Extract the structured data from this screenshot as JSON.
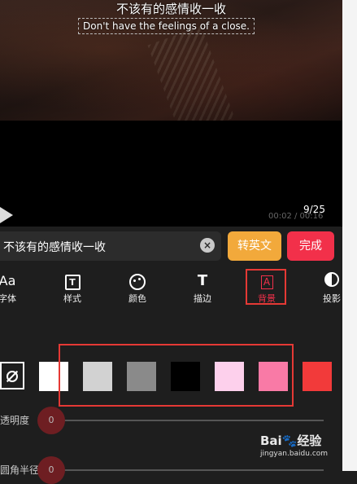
{
  "video": {
    "subtitle_cn": "不该有的感情收一收",
    "subtitle_en": "Don't have the feelings of a close.",
    "time_readout": "00:02 / 00:16",
    "counter": "9/25"
  },
  "input": {
    "value": "不该有的感情收一收",
    "clear_glyph": "×"
  },
  "buttons": {
    "translate_label": "转英文",
    "done_label": "完成",
    "translate_color": "#f2a93b",
    "done_color": "#f2304a"
  },
  "tabs": [
    {
      "label": "字体",
      "icon_text": "Aa",
      "icon": "font-icon"
    },
    {
      "label": "样式",
      "icon_text": "T",
      "icon": "style-icon"
    },
    {
      "label": "颜色",
      "icon": "palette-icon"
    },
    {
      "label": "描边",
      "icon_text": "T",
      "icon": "stroke-icon"
    },
    {
      "label": "背景",
      "icon_text": "A",
      "icon": "background-icon",
      "active": true
    },
    {
      "label": "投影",
      "icon": "shadow-icon"
    }
  ],
  "swatches": [
    {
      "name": "white",
      "color": "#ffffff"
    },
    {
      "name": "light-gray",
      "color": "#d2d2d2"
    },
    {
      "name": "gray",
      "color": "#8a8a8a"
    },
    {
      "name": "black",
      "color": "#000000"
    },
    {
      "name": "light-pink",
      "color": "#fdd0ec"
    },
    {
      "name": "pink",
      "color": "#f97aa6"
    },
    {
      "name": "red",
      "color": "#f23a3a"
    }
  ],
  "sliders": [
    {
      "label": "透明度",
      "value": "0"
    },
    {
      "label": "圆角半径",
      "value": "0"
    }
  ],
  "watermark": {
    "logo_pre": "Bai",
    "logo_paw": "🐾",
    "logo_post": "经验",
    "url": "jingyan.baidu.com"
  }
}
